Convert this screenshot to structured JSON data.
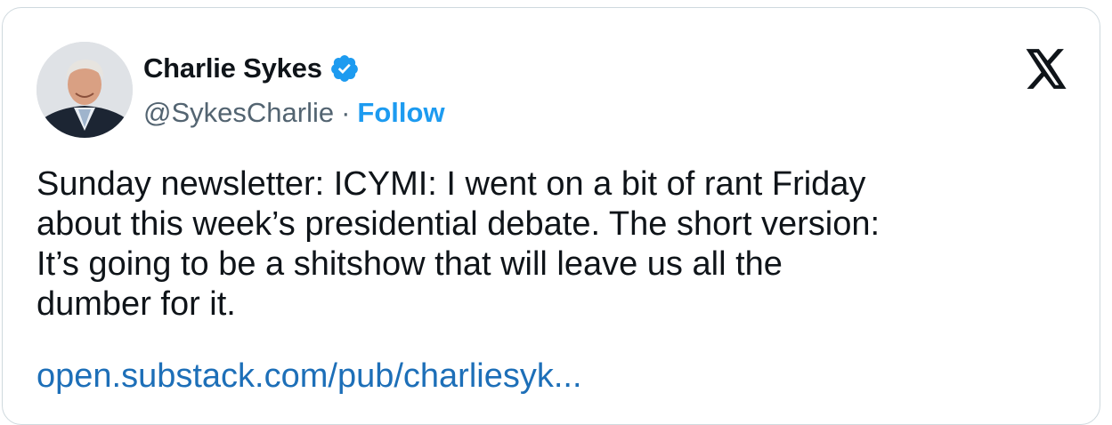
{
  "author": {
    "display_name": "Charlie Sykes",
    "handle": "@SykesCharlie",
    "separator": "·",
    "follow_label": "Follow",
    "verified": true
  },
  "tweet": {
    "lines": [
      "Sunday newsletter: ICYMI: I went on a bit of rant Friday",
      "about this week’s presidential debate. The short version:",
      "It’s going to be a shitshow that will leave us all the",
      "dumber for it."
    ],
    "link_text": "open.substack.com/pub/charliesyk..."
  },
  "icons": {
    "avatar": "profile-photo",
    "verified": "verified-badge-icon",
    "platform": "x-logo-icon"
  },
  "colors": {
    "text": "#0f1419",
    "secondary": "#536471",
    "accent": "#1d9bf0",
    "link": "#1d6fb8",
    "border": "#cfd9de"
  }
}
